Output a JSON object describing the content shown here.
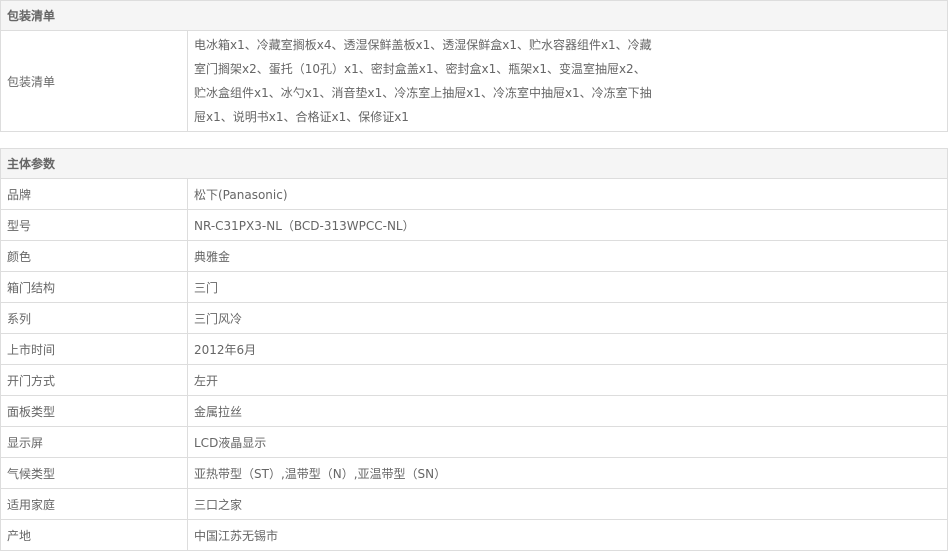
{
  "packing": {
    "section_title": "包装清单",
    "row_label": "包装清单",
    "contents": "电冰箱x1、冷藏室搁板x4、透湿保鲜盖板x1、透湿保鲜盒x1、贮水容器组件x1、冷藏室门搁架x2、蛋托（10孔）x1、密封盒盖x1、密封盒x1、瓶架x1、变温室抽屉x2、贮冰盒组件x1、冰勺x1、消音垫x1、冷冻室上抽屉x1、冷冻室中抽屉x1、冷冻室下抽屉x1、说明书x1、合格证x1、保修证x1"
  },
  "main_params": {
    "section_title": "主体参数",
    "rows": [
      {
        "label": "品牌",
        "value": "松下(Panasonic)"
      },
      {
        "label": "型号",
        "value": "NR-C31PX3-NL（BCD-313WPCC-NL）"
      },
      {
        "label": "颜色",
        "value": "典雅金"
      },
      {
        "label": "箱门结构",
        "value": "三门"
      },
      {
        "label": "系列",
        "value": "三门风冷"
      },
      {
        "label": "上市时间",
        "value": "2012年6月"
      },
      {
        "label": "开门方式",
        "value": "左开"
      },
      {
        "label": "面板类型",
        "value": "金属拉丝"
      },
      {
        "label": "显示屏",
        "value": "LCD液晶显示"
      },
      {
        "label": "气候类型",
        "value": "亚热带型（ST）,温带型（N）,亚温带型（SN）"
      },
      {
        "label": "适用家庭",
        "value": "三口之家"
      },
      {
        "label": "产地",
        "value": "中国江苏无锡市"
      }
    ]
  }
}
